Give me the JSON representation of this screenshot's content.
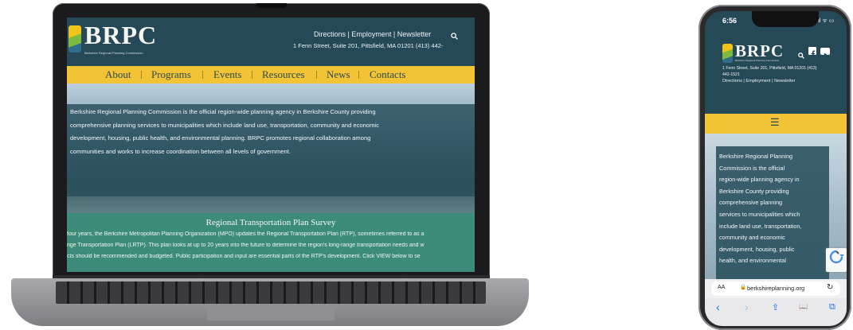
{
  "laptop": {
    "logo_text": "BRPC",
    "logo_subtitle": "Berkshire Regional Planning Commission",
    "top_links": "Directions  | Employment  | Newsletter",
    "search_icon": "search-icon",
    "address": "1 Fenn Street, Suite 201, Pittsfield, MA 01201 (413) 442-",
    "nav": [
      "About",
      "Programs",
      "Events",
      "Resources",
      "News",
      "Contacts"
    ],
    "hero_lines": [
      "Berkshire Regional Planning Commission is the official region-wide planning agency in Berkshire County providing",
      "comprehensive planning services to municipalities which include land use, transportation, community and economic",
      "development, housing, public health, and environmental planning. BRPC promotes regional collaboration among",
      "communities and works to increase coordination between all levels of government."
    ],
    "band_title": "Regional Transportation Plan Survey",
    "band_lines": [
      "four years, the Berkshire Metropolitan Planning Organization (MPO) updates the Regional Transportation Plan (RTP), sometimes referred to as a",
      "nge Transportation Plan (LRTP). This plan looks at up to 20 years into the future to determine the region's long-range transportation needs and w",
      "cts should be recommended and budgeted. Public participation and input are essential parts of the RTP's development. Click VIEW below to se"
    ]
  },
  "phone": {
    "time": "6:56",
    "status_icons": ".ıl ᯤ ▭",
    "logo_text": "BRPC",
    "logo_subtitle": "Berkshire Regional Planning Commission",
    "icons": [
      "search-icon",
      "facebook-icon",
      "youtube-icon"
    ],
    "address_line1": "1 Fenn Street, Suite 201, Pittsfield, MA 01201 (413)",
    "address_line2": "442-1521",
    "links": "Directions  | Employment  | Newsletter",
    "menu_icon": "☰",
    "hero_lines": [
      "Berkshire Regional Planning",
      "Commission is the official",
      "region-wide planning agency in",
      "Berkshire County providing",
      "comprehensive planning",
      "services to municipalities which",
      "include land use, transportation,",
      "community and economic",
      "development, housing, public",
      "health, and environmental"
    ],
    "url_aa": "AA",
    "url": "berkshireplanning.org",
    "lock_icon": "🔒",
    "reload_icon": "↻",
    "toolbar": [
      "‹",
      "›",
      "⇪",
      "📖",
      "⧉"
    ]
  },
  "colors": {
    "header_bg": "#254956",
    "nav_yellow": "#f2c335",
    "band_green": "#3d8c7a"
  }
}
